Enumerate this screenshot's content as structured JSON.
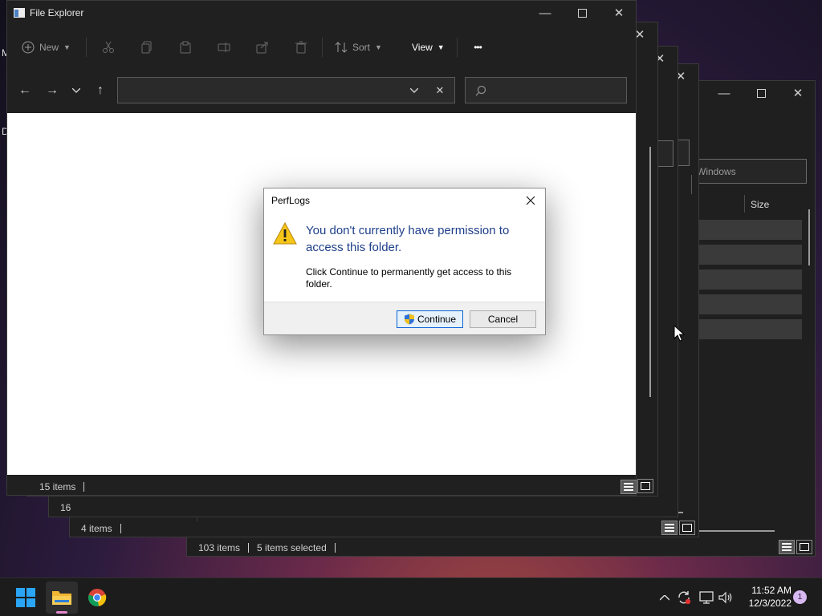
{
  "desktop": {
    "edge_letters": [
      "M",
      "D"
    ]
  },
  "back_window_3": {
    "search_placeholder": "h Windows",
    "column_size": "Size",
    "status_items": "103 items",
    "status_selected": "5 items selected"
  },
  "back_window_2": {
    "status_items": "4 items"
  },
  "back_window_1": {
    "status_items": "16"
  },
  "explorer": {
    "title": "File Explorer",
    "toolbar": {
      "new_label": "New",
      "sort_label": "Sort",
      "view_label": "View",
      "more_label": "•••"
    },
    "address_value": "",
    "search_placeholder": "",
    "status_items": "15 items"
  },
  "dialog": {
    "title": "PerfLogs",
    "heading": "You don't currently have permission to access this folder.",
    "body": "Click Continue to permanently get access to this folder.",
    "continue_label": "Continue",
    "cancel_label": "Cancel"
  },
  "taskbar": {
    "time": "11:52 AM",
    "date": "12/3/2022",
    "notification_count": "1"
  },
  "colors": {
    "accent": "#0a64d6",
    "dialog_heading": "#1e3f8a",
    "window_bg": "#1f1f1f",
    "notification_badge": "#d8b8f0"
  }
}
